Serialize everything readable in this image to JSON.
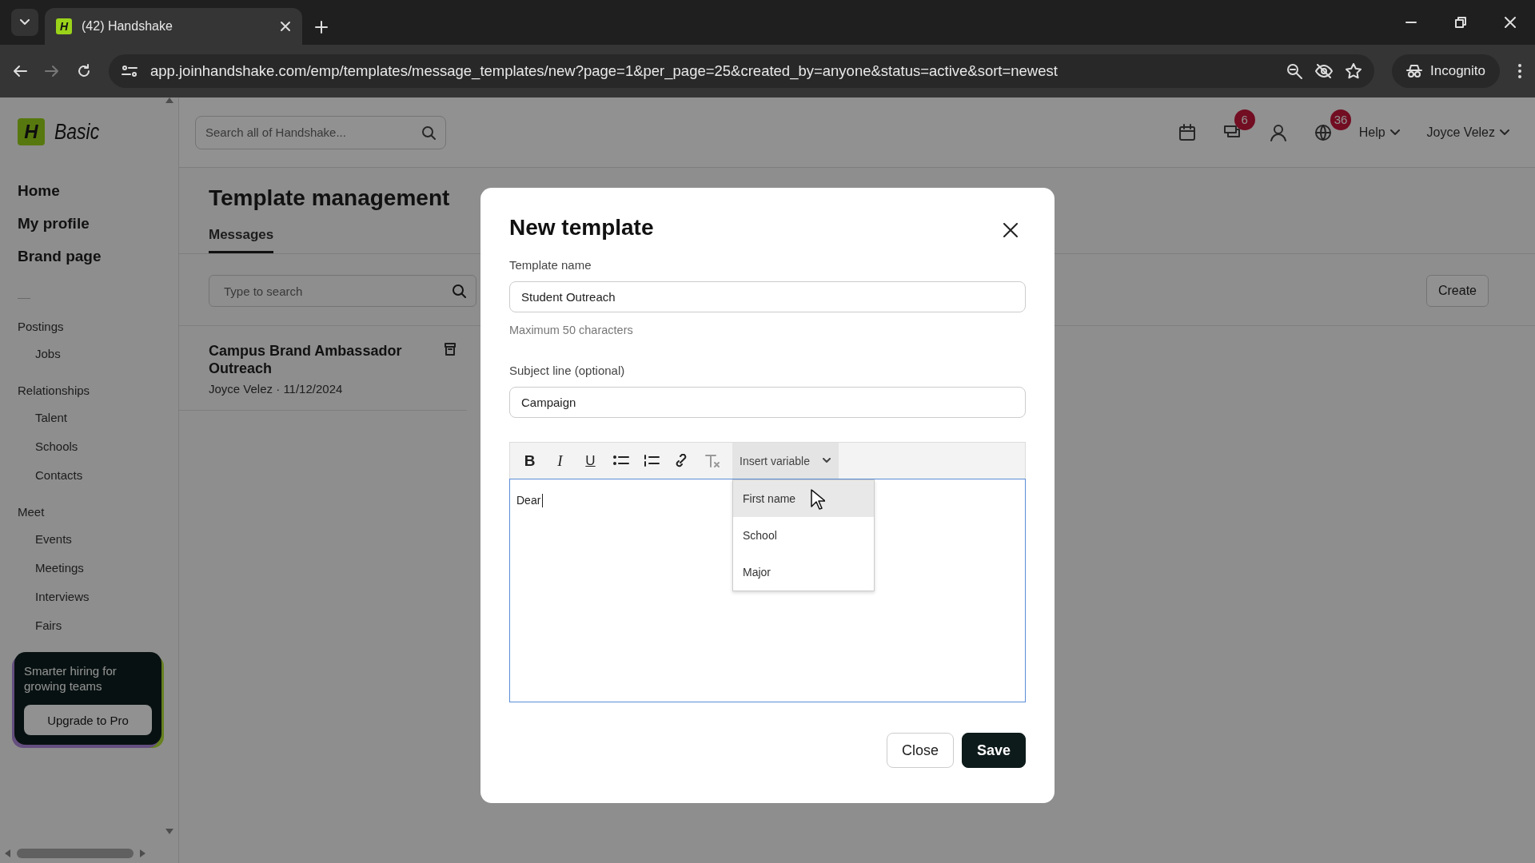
{
  "browser": {
    "favicon_letter": "H",
    "tab_title": "(42) Handshake",
    "url": "app.joinhandshake.com/emp/templates/message_templates/new?page=1&per_page=25&created_by=anyone&status=active&sort=newest",
    "profile": "Incognito"
  },
  "header": {
    "logo_letter": "H",
    "logo_text": "Basic",
    "search_placeholder": "Search all of Handshake...",
    "messages_badge": "6",
    "notifications_badge": "36",
    "help": "Help",
    "user": "Joyce Velez"
  },
  "sidebar": {
    "main_items": [
      "Home",
      "My profile",
      "Brand page"
    ],
    "sections": [
      {
        "title": "Postings",
        "items": [
          "Jobs"
        ]
      },
      {
        "title": "Relationships",
        "items": [
          "Talent",
          "Schools",
          "Contacts"
        ]
      },
      {
        "title": "Meet",
        "items": [
          "Events",
          "Meetings",
          "Interviews",
          "Fairs"
        ]
      }
    ],
    "promo": {
      "text": "Smarter hiring for growing teams",
      "button": "Upgrade to Pro"
    }
  },
  "page": {
    "title": "Template management",
    "tabs": [
      {
        "label": "Messages",
        "selected": true
      }
    ],
    "search_placeholder": "Type to search",
    "create_button": "Create",
    "templates": [
      {
        "title": "Campus Brand Ambassador Outreach",
        "meta": "Joyce Velez · 11/12/2024"
      }
    ]
  },
  "modal": {
    "title": "New template",
    "name_label": "Template name",
    "name_value": "Student Outreach",
    "name_hint": "Maximum 50 characters",
    "subject_label": "Subject line (optional)",
    "subject_value": "Campaign",
    "tools": [
      {
        "kind": "bold",
        "glyph": "B"
      },
      {
        "kind": "italic",
        "glyph": "I"
      },
      {
        "kind": "underline",
        "glyph": "U"
      },
      {
        "kind": "bullets"
      },
      {
        "kind": "numbers"
      },
      {
        "kind": "link"
      },
      {
        "kind": "clear"
      }
    ],
    "insert_variable": "Insert variable",
    "variables": [
      {
        "label": "First name",
        "highlighted": true
      },
      {
        "label": "School",
        "highlighted": false
      },
      {
        "label": "Major",
        "highlighted": false
      }
    ],
    "body": "Dear",
    "buttons": [
      {
        "kind": "secondary",
        "label": "Close"
      },
      {
        "kind": "primary",
        "label": "Save"
      }
    ]
  }
}
